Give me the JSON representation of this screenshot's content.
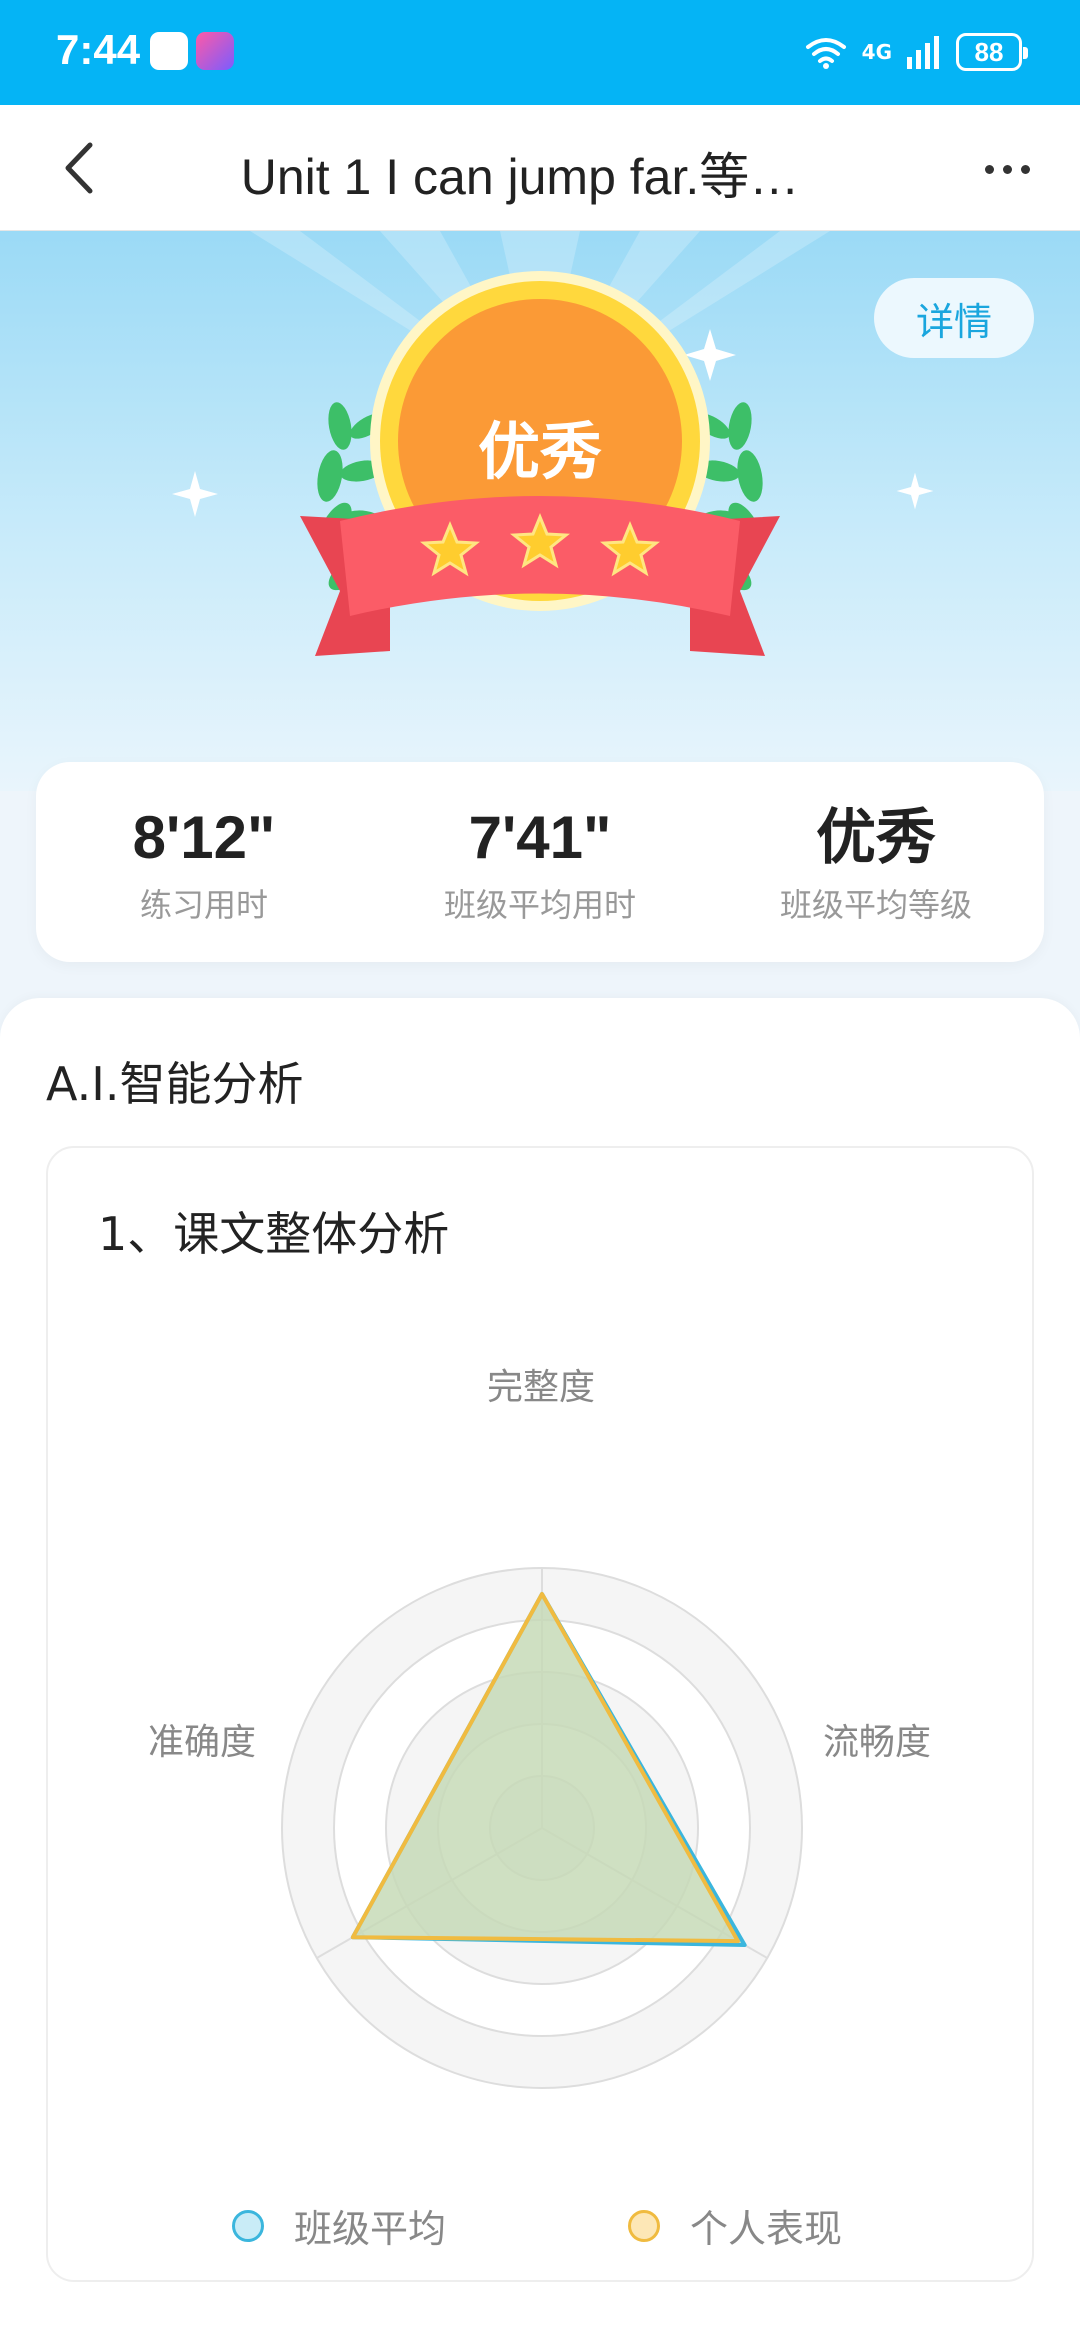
{
  "status_bar": {
    "time": "7:44",
    "network": "4G",
    "battery": "88"
  },
  "nav": {
    "title": "Unit 1 I can jump far.等…"
  },
  "hero": {
    "details_label": "详情",
    "grade": "优秀",
    "stars": 3
  },
  "stats": [
    {
      "value": "8'12\"",
      "label": "练习用时"
    },
    {
      "value": "7'41\"",
      "label": "班级平均用时"
    },
    {
      "value": "优秀",
      "label": "班级平均等级"
    }
  ],
  "analysis": {
    "title": "A.I.智能分析",
    "subtitle": "1、课文整体分析"
  },
  "chart_data": {
    "type": "radar",
    "axes": [
      "完整度",
      "流畅度",
      "准确度"
    ],
    "max": 100,
    "rings": 5,
    "series": [
      {
        "name": "班级平均",
        "values": [
          90,
          90,
          84
        ],
        "color": "#3bb6dd"
      },
      {
        "name": "个人表现",
        "values": [
          90,
          87,
          84
        ],
        "color": "#f0bb40"
      }
    ],
    "fill_color": "#c6d9b6"
  }
}
